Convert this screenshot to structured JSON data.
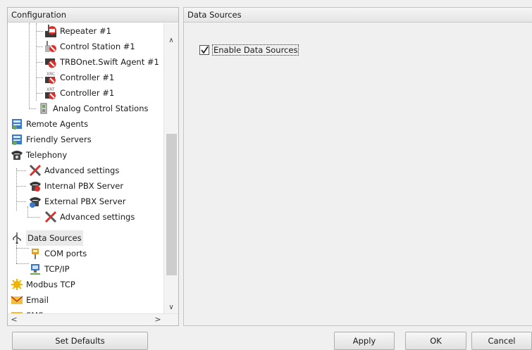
{
  "config_panel": {
    "header": "Configuration",
    "tree": [
      {
        "label": "Repeater #1",
        "icon": "repeater-icon"
      },
      {
        "label": "Control Station #1",
        "icon": "control-station-icon"
      },
      {
        "label": "TRBOnet.Swift Agent #1",
        "icon": "swift-agent-icon"
      },
      {
        "label": "Controller #1",
        "icon": "xrc-controller-icon"
      },
      {
        "label": "Controller #1",
        "icon": "xrt-controller-icon"
      },
      {
        "label": "Analog Control Stations",
        "icon": "analog-station-icon"
      },
      {
        "label": "Remote Agents",
        "icon": "remote-agents-icon"
      },
      {
        "label": "Friendly Servers",
        "icon": "friendly-servers-icon"
      },
      {
        "label": "Telephony",
        "icon": "telephone-icon"
      },
      {
        "label": "Advanced settings",
        "icon": "tools-icon"
      },
      {
        "label": "Internal PBX Server",
        "icon": "pbx-icon"
      },
      {
        "label": "External PBX Server",
        "icon": "pbx-icon"
      },
      {
        "label": "Advanced settings",
        "icon": "tools-icon"
      },
      {
        "label": "Data Sources",
        "icon": "usb-icon"
      },
      {
        "label": "COM ports",
        "icon": "com-port-icon"
      },
      {
        "label": "TCP/IP",
        "icon": "network-icon"
      },
      {
        "label": "Modbus TCP",
        "icon": "modbus-icon"
      },
      {
        "label": "Email",
        "icon": "email-icon"
      },
      {
        "label": "SMS",
        "icon": "sms-icon"
      }
    ],
    "selected_label": "Data Sources"
  },
  "data_sources_panel": {
    "header": "Data Sources",
    "enable_checkbox": {
      "label": "Enable Data Sources",
      "checked": true
    }
  },
  "buttons": {
    "set_defaults": "Set Defaults",
    "apply": "Apply",
    "ok": "OK",
    "cancel": "Cancel"
  },
  "colors": {
    "selected_background": "#eaeaea",
    "accent_red": "#d9302c"
  }
}
